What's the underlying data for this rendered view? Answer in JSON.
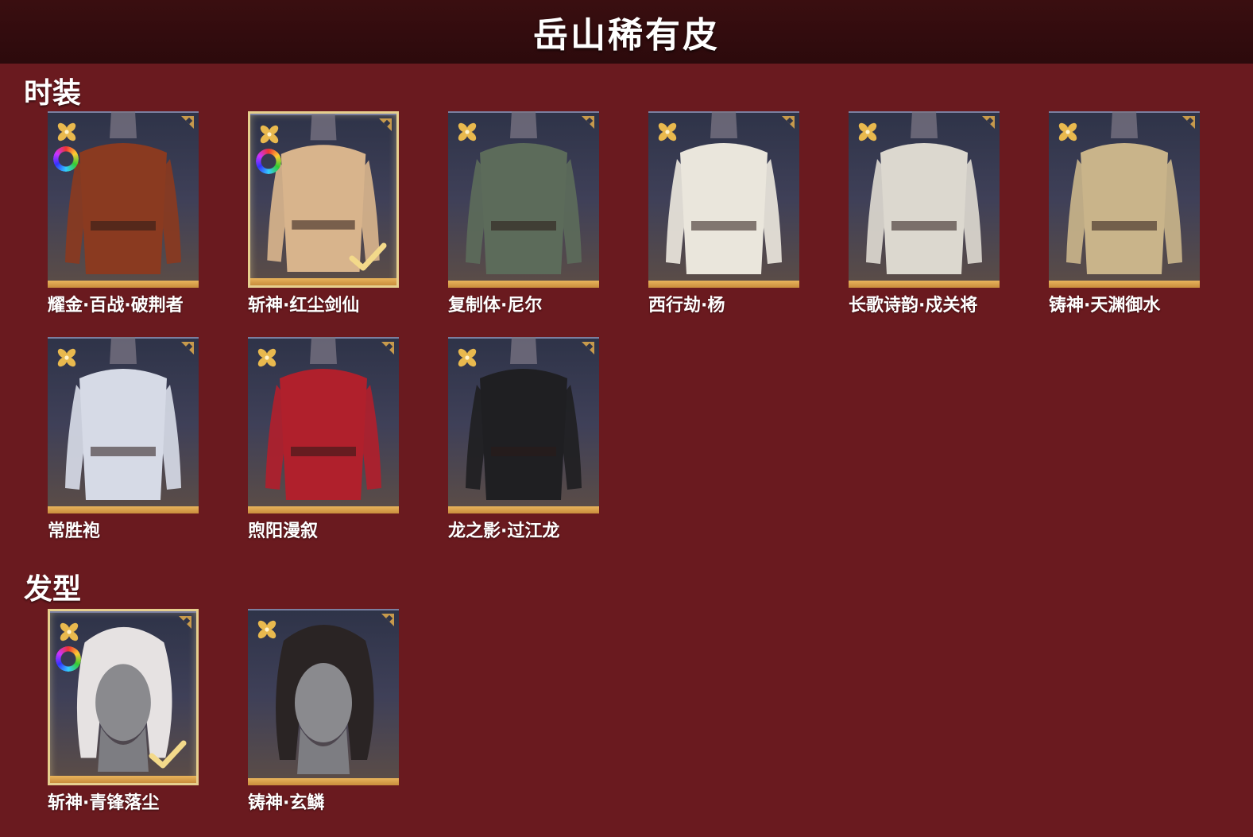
{
  "header": {
    "title": "岳山稀有皮"
  },
  "sections": {
    "outfits": {
      "title": "时装",
      "items": [
        {
          "label": "耀金·百战·破荆者",
          "selected": false,
          "dyeable": true,
          "outfit_color": "#8a3a20"
        },
        {
          "label": "斩神·红尘剑仙",
          "selected": true,
          "dyeable": true,
          "outfit_color": "#d8b48c"
        },
        {
          "label": "复制体·尼尔",
          "selected": false,
          "dyeable": false,
          "outfit_color": "#5c6b5a"
        },
        {
          "label": "西行劫·杨",
          "selected": false,
          "dyeable": false,
          "outfit_color": "#eae6dc"
        },
        {
          "label": "长歌诗韵·戍关将",
          "selected": false,
          "dyeable": false,
          "outfit_color": "#dcd8cf"
        },
        {
          "label": "铸神·天渊御水",
          "selected": false,
          "dyeable": false,
          "outfit_color": "#c9b48a"
        },
        {
          "label": "常胜袍",
          "selected": false,
          "dyeable": false,
          "outfit_color": "#d6dae6"
        },
        {
          "label": "煦阳漫叙",
          "selected": false,
          "dyeable": false,
          "outfit_color": "#b0202c"
        },
        {
          "label": "龙之影·过江龙",
          "selected": false,
          "dyeable": false,
          "outfit_color": "#1f1f22"
        }
      ]
    },
    "hairstyles": {
      "title": "发型",
      "items": [
        {
          "label": "斩神·青锋落尘",
          "selected": true,
          "dyeable": true,
          "hair_color": "#e6e2e2"
        },
        {
          "label": "铸神·玄鳞",
          "selected": false,
          "dyeable": false,
          "hair_color": "#2a2424"
        }
      ]
    }
  },
  "colors": {
    "background": "#6a1a1f",
    "title_bar": "#2c0a0c",
    "card_accent": "#e0a850",
    "selected_border": "#e6cf8e"
  },
  "icons": {
    "rarity": "gold-flower-icon",
    "dye": "color-wheel-icon",
    "selected": "checkmark-icon",
    "corner": "corner-badge-icon"
  }
}
